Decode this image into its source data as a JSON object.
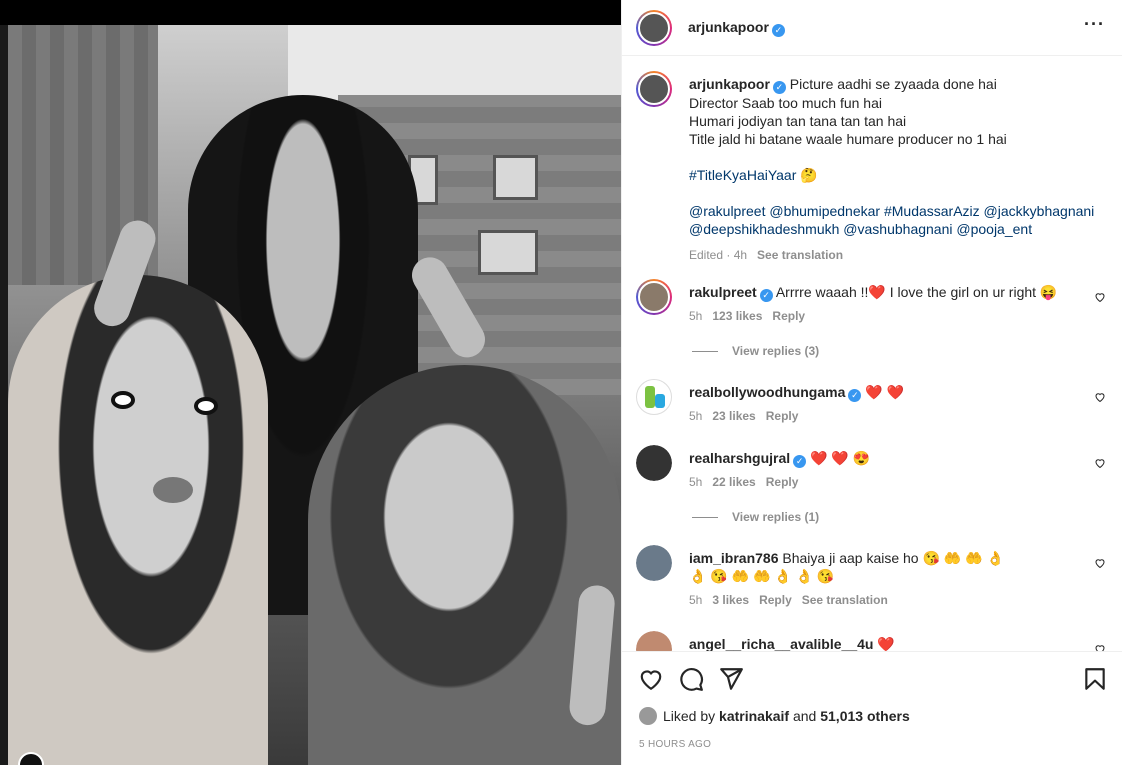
{
  "post": {
    "username": "arjunkapoor",
    "more_icon": "more-horizontal-icon"
  },
  "caption": {
    "username": "arjunkapoor",
    "lines": "Picture aadhi se zyaada done hai\nDirector Saab too much fun hai\nHumari jodiyan tan tana tan tan hai\nTitle jald hi batane waale humare producer no 1 hai",
    "hashtag": "#TitleKyaHaiYaar",
    "emoji": "🤔",
    "mentions_line1": "@rakulpreet @bhumipednekar #MudassarAziz @jackkybhagnani",
    "mentions_line2": "@deepshikhadeshmukh @vashubhagnani @pooja_ent",
    "edited": "Edited · 4h",
    "see_translation": "See translation"
  },
  "comments": [
    {
      "username": "rakulpreet",
      "text": "Arrrre waaah !!❤️  I love the girl on ur right  😝",
      "time": "5h",
      "likes": "123 likes",
      "reply": "Reply",
      "view_replies": "View replies (3)"
    },
    {
      "username": "realbollywoodhungama",
      "text": "❤️ ❤️",
      "time": "5h",
      "likes": "23 likes",
      "reply": "Reply"
    },
    {
      "username": "realharshgujral",
      "text": "❤️ ❤️ 😍",
      "time": "5h",
      "likes": "22 likes",
      "reply": "Reply",
      "view_replies": "View replies (1)"
    },
    {
      "username": "iam_ibran786",
      "text": "Bhaiya ji aap kaise ho 😘 🤲 🤲 👌 👌 😘 🤲 🤲 👌 👌 😘",
      "time": "5h",
      "likes": "3 likes",
      "reply": "Reply",
      "see_translation": "See translation"
    },
    {
      "username": "angel__richa__avalible__4u",
      "text": "❤️"
    }
  ],
  "actions": {
    "like_icon": "heart-icon",
    "comment_icon": "comment-icon",
    "share_icon": "send-icon",
    "save_icon": "bookmark-icon"
  },
  "likes": {
    "prefix": "Liked by",
    "user": "katrinakaif",
    "middle": "and",
    "others": "51,013 others"
  },
  "timestamp": "5 HOURS AGO",
  "colors": {
    "link": "#00376b",
    "verified": "#3897f0",
    "muted": "#8e8e8e",
    "heart": "#ed4956"
  }
}
